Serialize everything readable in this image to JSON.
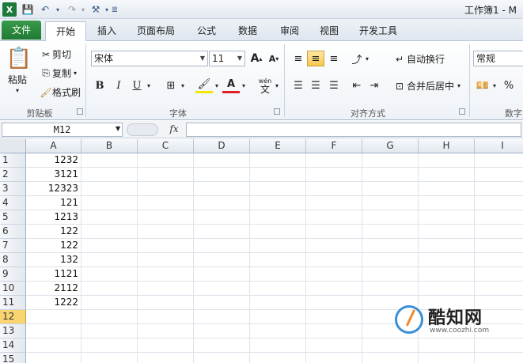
{
  "window": {
    "title": "工作簿1 - M"
  },
  "tabs": [
    "文件",
    "开始",
    "插入",
    "页面布局",
    "公式",
    "数据",
    "审阅",
    "视图",
    "开发工具"
  ],
  "active_tab": "开始",
  "ribbon": {
    "clipboard": {
      "paste": "粘贴",
      "cut": "剪切",
      "copy": "复制",
      "format_painter": "格式刷",
      "label": "剪贴板"
    },
    "font": {
      "name": "宋体",
      "size": "11",
      "grow": "A",
      "shrink": "A",
      "bold": "B",
      "italic": "I",
      "underline": "U",
      "label": "字体",
      "phonetic": "wén"
    },
    "alignment": {
      "wrap_text": "自动换行",
      "merge_center": "合并后居中",
      "label": "对齐方式"
    },
    "number": {
      "format": "常规",
      "percent": "%",
      "label": "数字"
    }
  },
  "formula_bar": {
    "name_box": "M12",
    "fx": "fx",
    "value": ""
  },
  "grid": {
    "columns": [
      "A",
      "B",
      "C",
      "D",
      "E",
      "F",
      "G",
      "H",
      "I"
    ],
    "rows": [
      "1",
      "2",
      "3",
      "4",
      "5",
      "6",
      "7",
      "8",
      "9",
      "10",
      "11",
      "12",
      "13",
      "14",
      "15"
    ],
    "selected_row": "12",
    "column_a_values": [
      "1232",
      "3121",
      "12323",
      "121",
      "1213",
      "122",
      "122",
      "132",
      "1121",
      "2112",
      "1222"
    ]
  },
  "watermark": {
    "name": "酷知网",
    "url": "www.coozhi.com"
  },
  "colors": {
    "file_tab": "#1f7a32",
    "selected_row_header": "#f9d471",
    "watermark_blue": "#3a8fd6",
    "watermark_orange": "#f08a2a"
  }
}
